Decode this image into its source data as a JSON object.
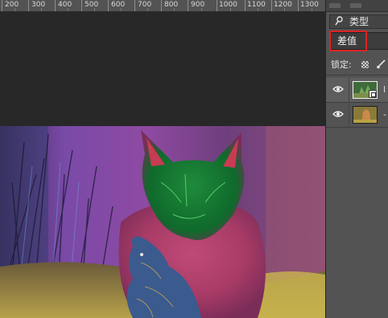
{
  "ruler": {
    "labels": [
      "200",
      "300",
      "400",
      "500",
      "600",
      "700",
      "800",
      "900",
      "1000",
      "1100",
      "1200",
      "1300"
    ]
  },
  "layers_panel": {
    "filter": {
      "label": "类型",
      "icon": "search-icon"
    },
    "blend_mode": {
      "value": "差值",
      "highlighted": true,
      "highlight_color": "#e02222"
    },
    "lock": {
      "label": "锁定:",
      "icons": [
        "lock-transparent-pixels-icon",
        "lock-image-pixels-icon"
      ]
    },
    "layers": [
      {
        "name": "l",
        "visible": true,
        "selected": true,
        "smart_object": true
      },
      {
        "name": "-",
        "visible": true,
        "selected": false,
        "smart_object": false
      }
    ]
  },
  "colors": {
    "workspace": "#282828",
    "panel": "#535353",
    "highlight": "#e02222"
  }
}
